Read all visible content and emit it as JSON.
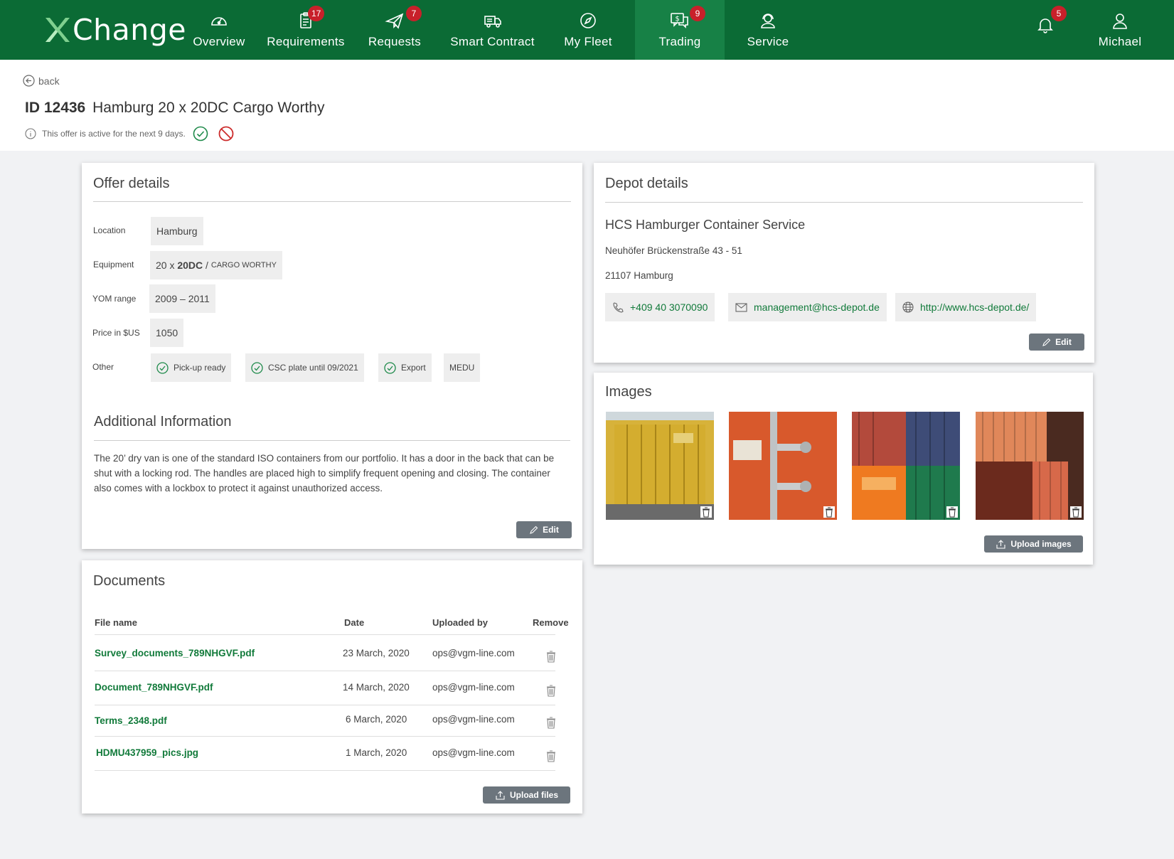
{
  "brand": "Change",
  "nav": {
    "items": [
      {
        "label": "Overview",
        "badge": ""
      },
      {
        "label": "Requirements",
        "badge": "17"
      },
      {
        "label": "Requests",
        "badge": "7"
      },
      {
        "label": "Smart Contract",
        "badge": ""
      },
      {
        "label": "My Fleet",
        "badge": ""
      },
      {
        "label": "Trading",
        "badge": "9"
      },
      {
        "label": "Service",
        "badge": ""
      }
    ],
    "notifications_badge": "5",
    "user": "Michael"
  },
  "header": {
    "back": "back",
    "id_label": "ID 12436",
    "title": "Hamburg 20 x 20DC Cargo Worthy",
    "status_text": "This offer is active for the next 9 days."
  },
  "offer": {
    "title": "Offer details",
    "location_label": "Location",
    "location_value": "Hamburg",
    "equipment_label": "Equipment",
    "equipment_qty": "20 x ",
    "equipment_type": "20DC",
    "equipment_sep": " / ",
    "equipment_cond": "Cargo Worthy",
    "yom_label": "YOM range",
    "yom_value": "2009 – 2011",
    "price_label": "Price in $US",
    "price_value": "1050",
    "other_label": "Other",
    "other_tags": [
      "Pick-up ready",
      "CSC plate until 09/2021",
      "Export",
      "MEDU"
    ],
    "additional_title": "Additional Information",
    "additional_text": "The 20’ dry van is one of the standard ISO containers from our portfolio. It has a door in the back that can be shut with a locking rod. The handles are placed high to simplify frequent opening and closing. The container also comes with a lockbox to protect it against unauthorized access.",
    "edit": "Edit"
  },
  "depot": {
    "title": "Depot details",
    "name": "HCS Hamburger Container Service",
    "street": "Neuhöfer Brückenstraße 43 - 51",
    "city": "21107 Hamburg",
    "phone": "+409 40 3070090",
    "email": "management@hcs-depot.de",
    "web": "http://www.hcs-depot.de/",
    "edit": "Edit"
  },
  "images": {
    "title": "Images",
    "upload": "Upload images"
  },
  "documents": {
    "title": "Documents",
    "headers": [
      "File name",
      "Date",
      "Uploaded by",
      "Remove"
    ],
    "rows": [
      {
        "file": "Survey_documents_789NHGVF.pdf",
        "date": "23 March, 2020",
        "by": "ops@vgm-line.com"
      },
      {
        "file": "Document_789NHGVF.pdf",
        "date": "14 March, 2020",
        "by": "ops@vgm-line.com"
      },
      {
        "file": "Terms_2348.pdf",
        "date": "6 March, 2020",
        "by": "ops@vgm-line.com"
      },
      {
        "file": "HDMU437959_pics.jpg",
        "date": "1 March, 2020",
        "by": "ops@vgm-line.com"
      }
    ],
    "upload": "Upload files"
  }
}
